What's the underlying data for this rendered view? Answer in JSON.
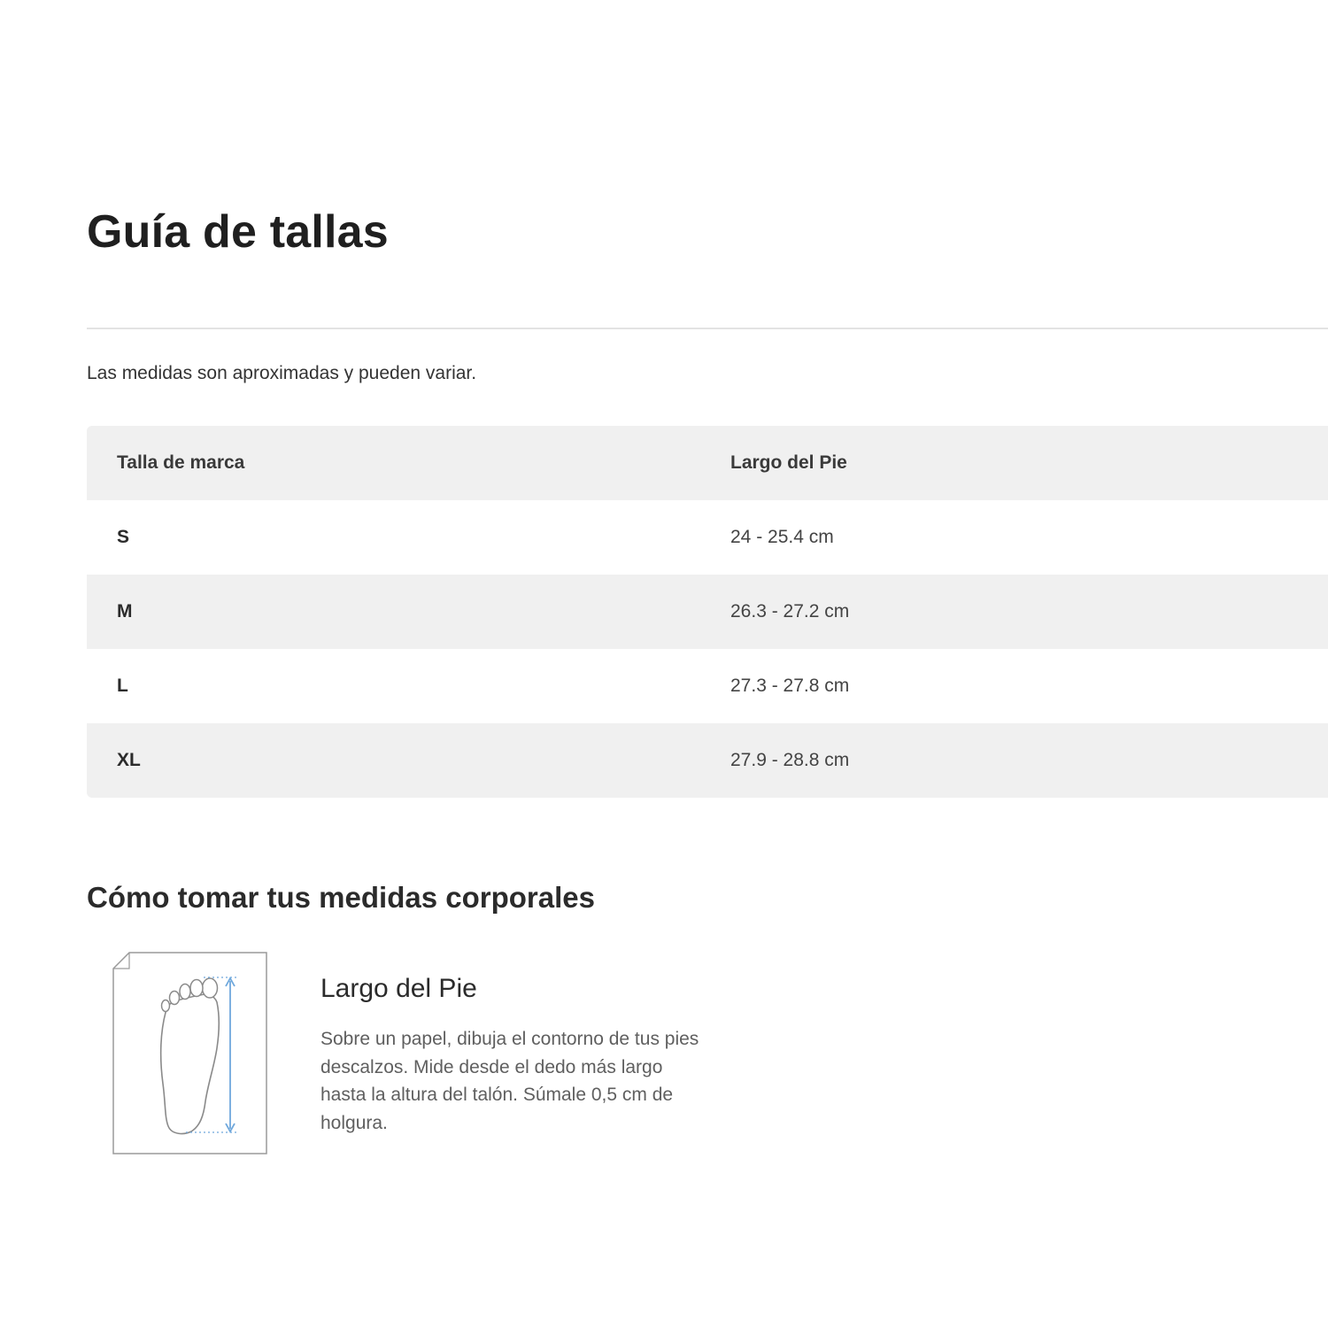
{
  "page": {
    "title": "Guía de tallas",
    "disclaimer": "Las medidas son aproximadas y pueden variar."
  },
  "table": {
    "headers": [
      "Talla de marca",
      "Largo del Pie"
    ],
    "rows": [
      {
        "size": "S",
        "length": "24 - 25.4 cm"
      },
      {
        "size": "M",
        "length": "26.3 - 27.2 cm"
      },
      {
        "size": "L",
        "length": "27.3 - 27.8 cm"
      },
      {
        "size": "XL",
        "length": "27.9 - 28.8 cm"
      }
    ]
  },
  "measurements": {
    "section_title": "Cómo tomar tus medidas corporales",
    "items": [
      {
        "icon": "foot-measure-icon",
        "title": "Largo del Pie",
        "description": "Sobre un papel, dibuja el contorno de tus pies descalzos. Mide desde el dedo más largo hasta la altura del talón. Súmale 0,5 cm de holgura."
      }
    ]
  },
  "colors": {
    "row_shade": "#f0f0f0",
    "divider": "#e3e3e3",
    "measure_line": "#6fa8dc"
  }
}
